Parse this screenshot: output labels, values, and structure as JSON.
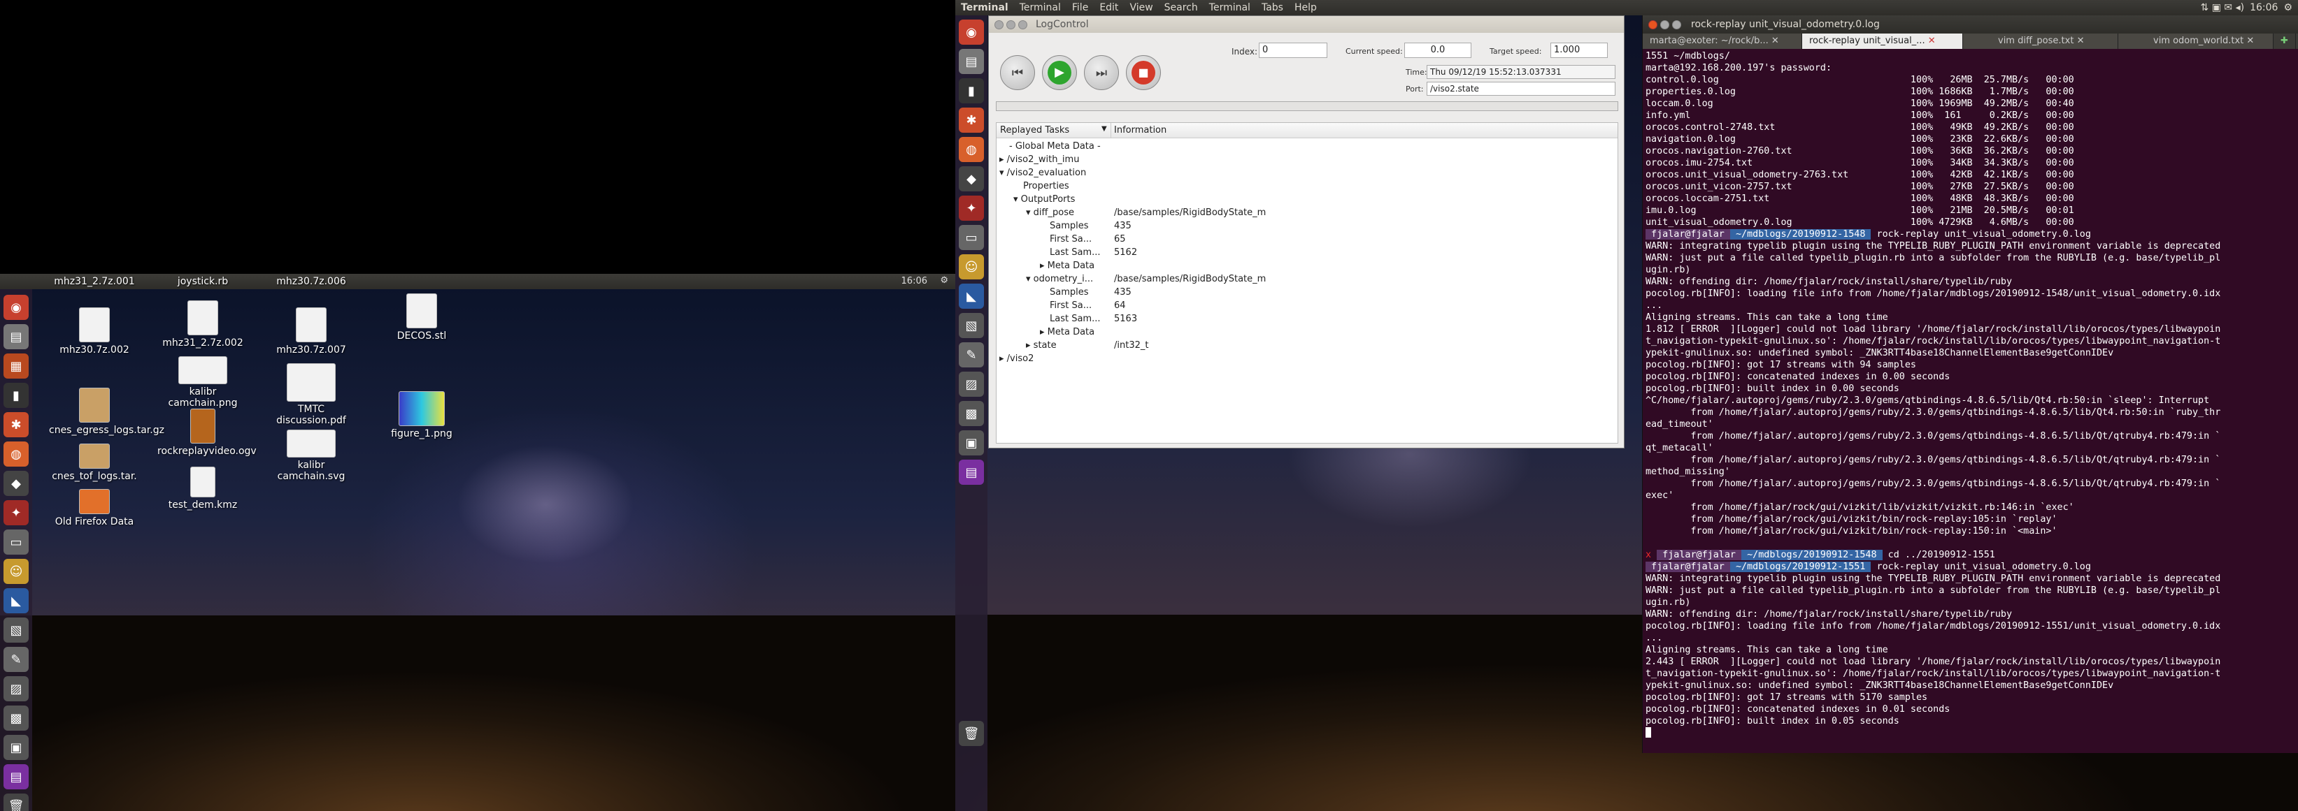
{
  "left_topbar": {
    "time": "16:06"
  },
  "desktop_icons": [
    {
      "label": "mhz31_2.7z.001"
    },
    {
      "label": "joystick.rb"
    },
    {
      "label": "mhz30.7z.006"
    },
    {
      "label": "mhz30.7z.002"
    },
    {
      "label": "mhz31_2.7z.002"
    },
    {
      "label": "mhz30.7z.007"
    },
    {
      "label": "DECOS.stl"
    },
    {
      "label": "kalibr camchain.png"
    },
    {
      "label": "TMTC discussion.pdf"
    },
    {
      "label": "figure_1.png"
    },
    {
      "label": "cnes_egress_logs.tar.gz"
    },
    {
      "label": "rockreplayvideo.ogv"
    },
    {
      "label": "kalibr camchain.svg"
    },
    {
      "label": "cnes_tof_logs.tar."
    },
    {
      "label": "test_dem.kmz"
    },
    {
      "label": "Old Firefox Data"
    }
  ],
  "topbar": {
    "app": "Terminal",
    "menus": [
      "Terminal",
      "File",
      "Edit",
      "View",
      "Search",
      "Terminal",
      "Tabs",
      "Help"
    ],
    "time": "16:06"
  },
  "logcontrol": {
    "title": "LogControl",
    "index_label": "Index:",
    "index_value": "0",
    "current_speed_label": "Current speed:",
    "current_speed_value": "0.0",
    "target_speed_label": "Target speed:",
    "target_speed_value": "1.000",
    "time_label": "Time:",
    "time_value": "Thu 09/12/19 15:52:13.037331",
    "port_label": "Port:",
    "port_value": "/viso2.state",
    "col_tasks": "Replayed Tasks",
    "col_info": "Information",
    "rows": [
      {
        "label": "- Global Meta Data -",
        "info": ""
      },
      {
        "label": "/viso2_with_imu",
        "info": ""
      },
      {
        "label": "/viso2_evaluation",
        "info": ""
      },
      {
        "label": "Properties",
        "info": ""
      },
      {
        "label": "OutputPorts",
        "info": ""
      },
      {
        "label": "diff_pose",
        "info": "/base/samples/RigidBodyState_m"
      },
      {
        "label": "Samples",
        "info": "435"
      },
      {
        "label": "First Sa...",
        "info": "65"
      },
      {
        "label": "Last Sam...",
        "info": "5162"
      },
      {
        "label": "Meta Data",
        "info": ""
      },
      {
        "label": "odometry_i...",
        "info": "/base/samples/RigidBodyState_m"
      },
      {
        "label": "Samples",
        "info": "435"
      },
      {
        "label": "First Sa...",
        "info": "64"
      },
      {
        "label": "Last Sam...",
        "info": "5163"
      },
      {
        "label": "Meta Data",
        "info": ""
      },
      {
        "label": "state",
        "info": "/int32_t"
      },
      {
        "label": "/viso2",
        "info": ""
      }
    ]
  },
  "terminal": {
    "title": "rock-replay unit_visual_odometry.0.log",
    "tabs": [
      "marta@exoter: ~/rock/b...",
      "rock-replay unit_visual_...",
      "vim diff_pose.txt",
      "vim odom_world.txt"
    ],
    "lines": [
      "1551 ~/mdblogs/",
      "marta@192.168.200.197's password:",
      "control.0.log                                  100%   26MB  25.7MB/s   00:00",
      "properties.0.log                               100% 1686KB   1.7MB/s   00:00",
      "loccam.0.log                                   100% 1969MB  49.2MB/s   00:40",
      "info.yml                                       100%  161     0.2KB/s   00:00",
      "orocos.control-2748.txt                        100%   49KB  49.2KB/s   00:00",
      "navigation.0.log                               100%   23KB  22.6KB/s   00:00",
      "orocos.navigation-2760.txt                     100%   36KB  36.2KB/s   00:00",
      "orocos.imu-2754.txt                            100%   34KB  34.3KB/s   00:00",
      "orocos.unit_visual_odometry-2763.txt           100%   42KB  42.1KB/s   00:00",
      "orocos.unit_vicon-2757.txt                     100%   27KB  27.5KB/s   00:00",
      "orocos.loccam-2751.txt                         100%   48KB  48.3KB/s   00:00",
      "imu.0.log                                      100%   21MB  20.5MB/s   00:01",
      "unit_visual_odometry.0.log                     100% 4729KB   4.6MB/s   00:00",
      "fjalar@fjalar  ~/mdblogs/20190912-1548  rock-replay unit_visual_odometry.0.log",
      "WARN: integrating typelib plugin using the TYPELIB_RUBY_PLUGIN_PATH environment variable is deprecated",
      "WARN: just put a file called typelib_plugin.rb into a subfolder from the RUBYLIB (e.g. base/typelib_pl",
      "ugin.rb)",
      "WARN: offending dir: /home/fjalar/rock/install/share/typelib/ruby",
      "pocolog.rb[INFO]: loading file info from /home/fjalar/mdblogs/20190912-1548/unit_visual_odometry.0.idx",
      "...",
      "Aligning streams. This can take a long time",
      "1.812 [ ERROR  ][Logger] could not load library '/home/fjalar/rock/install/lib/orocos/types/libwaypoin",
      "t_navigation-typekit-gnulinux.so': /home/fjalar/rock/install/lib/orocos/types/libwaypoint_navigation-t",
      "ypekit-gnulinux.so: undefined symbol: _ZNK3RTT4base18ChannelElementBase9getConnIDEv",
      "pocolog.rb[INFO]: got 17 streams with 94 samples",
      "pocolog.rb[INFO]: concatenated indexes in 0.00 seconds",
      "pocolog.rb[INFO]: built index in 0.00 seconds",
      "^C/home/fjalar/.autoproj/gems/ruby/2.3.0/gems/qtbindings-4.8.6.5/lib/Qt4.rb:50:in `sleep': Interrupt",
      "        from /home/fjalar/.autoproj/gems/ruby/2.3.0/gems/qtbindings-4.8.6.5/lib/Qt4.rb:50:in `ruby_thr",
      "ead_timeout'",
      "        from /home/fjalar/.autoproj/gems/ruby/2.3.0/gems/qtbindings-4.8.6.5/lib/Qt/qtruby4.rb:479:in `",
      "qt_metacall'",
      "        from /home/fjalar/.autoproj/gems/ruby/2.3.0/gems/qtbindings-4.8.6.5/lib/Qt/qtruby4.rb:479:in `",
      "method_missing'",
      "        from /home/fjalar/.autoproj/gems/ruby/2.3.0/gems/qtbindings-4.8.6.5/lib/Qt/qtruby4.rb:479:in `",
      "exec'",
      "        from /home/fjalar/rock/gui/vizkit/lib/vizkit/vizkit.rb:146:in `exec'",
      "        from /home/fjalar/rock/gui/vizkit/bin/rock-replay:105:in `replay'",
      "        from /home/fjalar/rock/gui/vizkit/bin/rock-replay:150:in `<main>'",
      "",
      "x fjalar@fjalar  ~/mdblogs/20190912-1548  cd ../20190912-1551",
      "fjalar@fjalar  ~/mdblogs/20190912-1551  rock-replay unit_visual_odometry.0.log",
      "WARN: integrating typelib plugin using the TYPELIB_RUBY_PLUGIN_PATH environment variable is deprecated",
      "WARN: just put a file called typelib_plugin.rb into a subfolder from the RUBYLIB (e.g. base/typelib_pl",
      "ugin.rb)",
      "WARN: offending dir: /home/fjalar/rock/install/share/typelib/ruby",
      "pocolog.rb[INFO]: loading file info from /home/fjalar/mdblogs/20190912-1551/unit_visual_odometry.0.idx",
      "...",
      "Aligning streams. This can take a long time",
      "2.443 [ ERROR  ][Logger] could not load library '/home/fjalar/rock/install/lib/orocos/types/libwaypoin",
      "t_navigation-typekit-gnulinux.so': /home/fjalar/rock/install/lib/orocos/types/libwaypoint_navigation-t",
      "ypekit-gnulinux.so: undefined symbol: _ZNK3RTT4base18ChannelElementBase9getConnIDEv",
      "pocolog.rb[INFO]: got 17 streams with 5170 samples",
      "pocolog.rb[INFO]: concatenated indexes in 0.01 seconds",
      "pocolog.rb[INFO]: built index in 0.05 seconds"
    ]
  }
}
